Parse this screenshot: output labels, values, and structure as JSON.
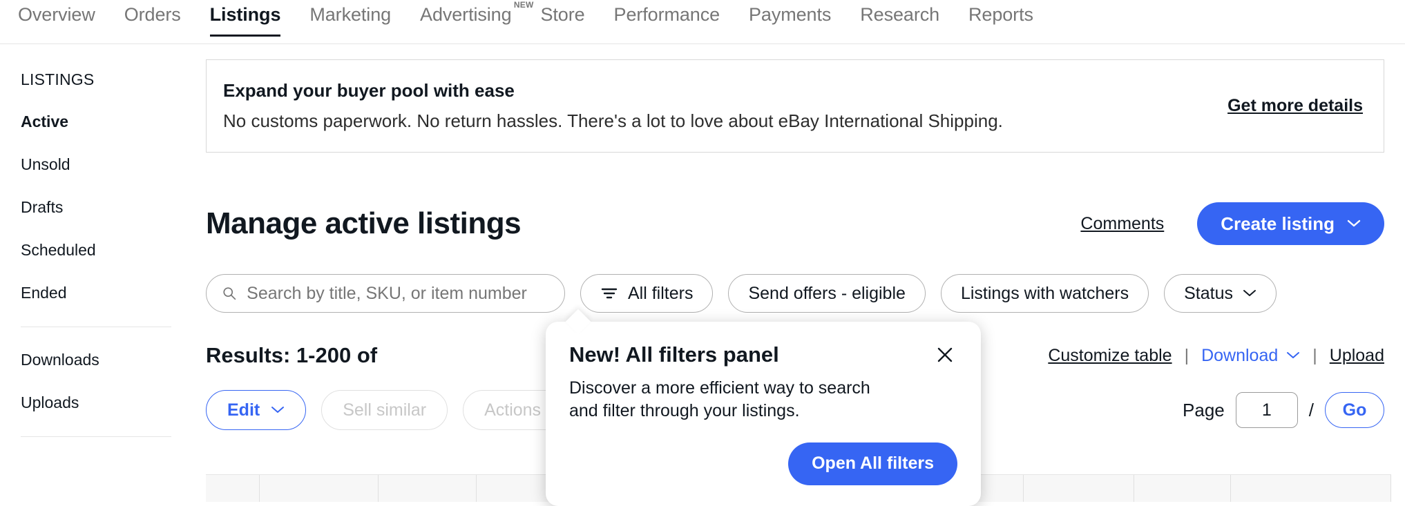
{
  "topnav": {
    "items": [
      {
        "label": "Overview",
        "active": false,
        "sup": ""
      },
      {
        "label": "Orders",
        "active": false,
        "sup": ""
      },
      {
        "label": "Listings",
        "active": true,
        "sup": ""
      },
      {
        "label": "Marketing",
        "active": false,
        "sup": ""
      },
      {
        "label": "Advertising",
        "active": false,
        "sup": "NEW"
      },
      {
        "label": "Store",
        "active": false,
        "sup": ""
      },
      {
        "label": "Performance",
        "active": false,
        "sup": ""
      },
      {
        "label": "Payments",
        "active": false,
        "sup": ""
      },
      {
        "label": "Research",
        "active": false,
        "sup": ""
      },
      {
        "label": "Reports",
        "active": false,
        "sup": ""
      }
    ]
  },
  "sidebar": {
    "heading": "LISTINGS",
    "items": [
      {
        "label": "Active",
        "active": true
      },
      {
        "label": "Unsold",
        "active": false
      },
      {
        "label": "Drafts",
        "active": false
      },
      {
        "label": "Scheduled",
        "active": false
      },
      {
        "label": "Ended",
        "active": false
      }
    ],
    "items2": [
      {
        "label": "Downloads",
        "active": false
      },
      {
        "label": "Uploads",
        "active": false
      }
    ]
  },
  "promo": {
    "title": "Expand your buyer pool with ease",
    "subtitle": "No customs paperwork. No return hassles. There's a lot to love about eBay International Shipping.",
    "link": "Get more details"
  },
  "header": {
    "title": "Manage active listings",
    "comments_link": "Comments",
    "create_button": "Create listing"
  },
  "filters": {
    "search_placeholder": "Search by title, SKU, or item number",
    "search_value": "",
    "all_filters": "All filters",
    "chips": [
      {
        "label": "Send offers - eligible",
        "caret": false
      },
      {
        "label": "Listings with watchers",
        "caret": false
      },
      {
        "label": "Status",
        "caret": true
      }
    ]
  },
  "results": {
    "text": "Results: 1-200 of",
    "customize_table": "Customize table",
    "download": "Download",
    "upload": "Upload",
    "separator": "|"
  },
  "actions": {
    "edit": "Edit",
    "sell_similar": "Sell similar",
    "actions": "Actions",
    "page_label": "Page",
    "page_value": "1",
    "page_slash": "/",
    "go": "Go"
  },
  "popover": {
    "title": "New! All filters panel",
    "body": "Discover a more efficient way to search and filter through your listings.",
    "button": "Open All filters"
  },
  "colors": {
    "brand_blue": "#3665f3",
    "text_dark": "#111820",
    "text_muted": "#767676",
    "disabled": "#c7c7c7",
    "strip_bg": "#f7f7f7"
  }
}
